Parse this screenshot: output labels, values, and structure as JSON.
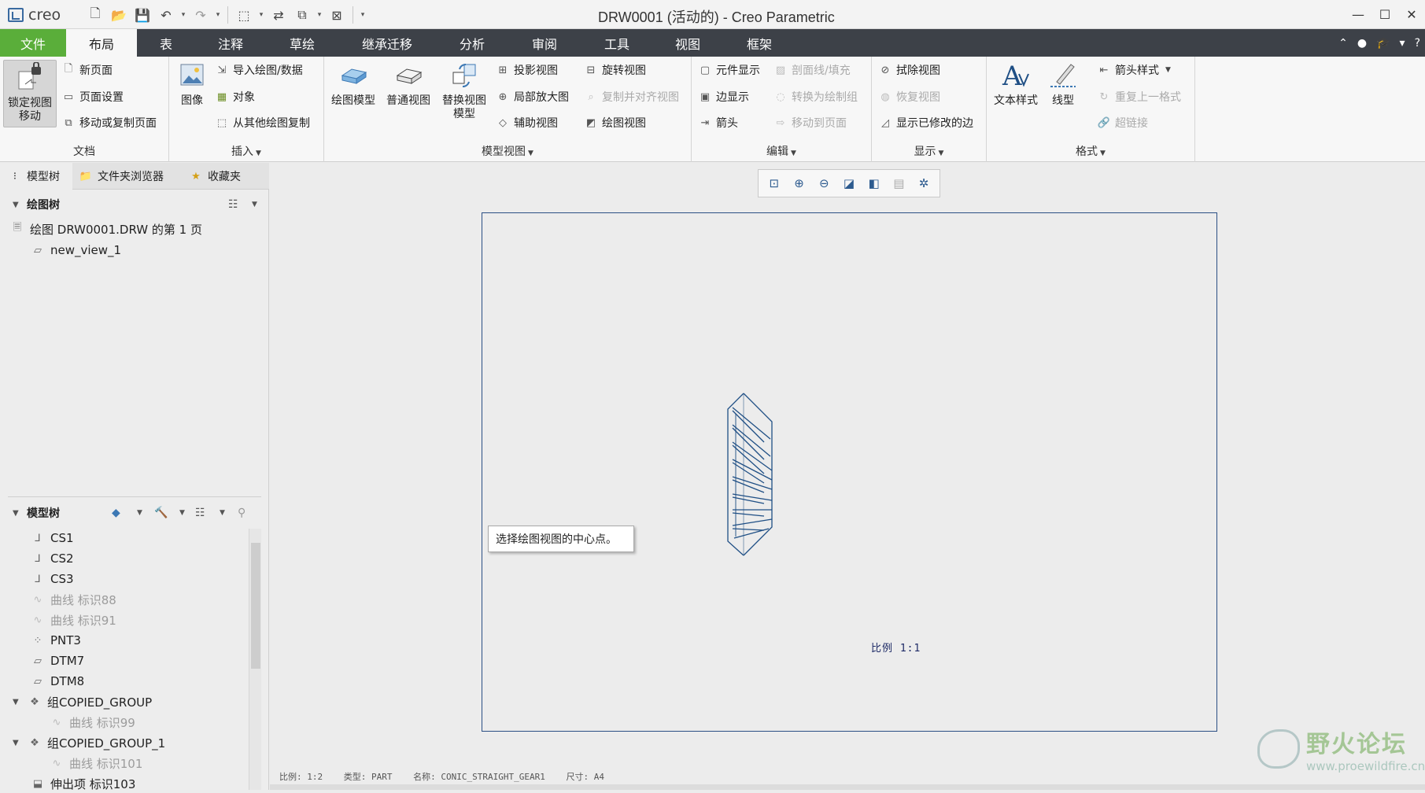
{
  "app": {
    "logo_text": "creo",
    "window_title": "DRW0001 (活动的) - Creo Parametric"
  },
  "menu": {
    "tabs": [
      "文件",
      "布局",
      "表",
      "注释",
      "草绘",
      "继承迁移",
      "分析",
      "审阅",
      "工具",
      "视图",
      "框架"
    ],
    "active_tab": "布局"
  },
  "ribbon": {
    "document": {
      "label": "文档",
      "lock_view": "锁定视图\n移动",
      "new_page": "新页面",
      "page_setup": "页面设置",
      "move_copy_page": "移动或复制页面"
    },
    "insert": {
      "label": "插入",
      "image": "图像",
      "import_data": "导入绘图/数据",
      "object": "对象",
      "copy_from_other": "从其他绘图复制"
    },
    "model_views": {
      "label": "模型视图",
      "drawing_model": "绘图模型",
      "general_view": "普通视图",
      "replace_view_model": "替换视图\n模型",
      "projection_view": "投影视图",
      "detailed_view": "局部放大图",
      "auxiliary_view": "辅助视图",
      "revolved_view": "旋转视图",
      "copy_align_view": "复制并对齐视图",
      "drawing_view": "绘图视图"
    },
    "edit": {
      "label": "编辑",
      "component_display": "元件显示",
      "edge_display": "边显示",
      "arrows": "箭头",
      "hatching": "剖面线/填充",
      "convert_to_draft": "转换为绘制组",
      "move_to_page": "移动到页面"
    },
    "display": {
      "label": "显示",
      "erase_view": "拭除视图",
      "resume_view": "恢复视图",
      "show_modified_edges": "显示已修改的边"
    },
    "format": {
      "label": "格式",
      "text_style": "文本样式",
      "line_style": "线型",
      "arrow_style": "箭头样式",
      "repeat_last_format": "重复上一格式",
      "hyperlink": "超链接"
    }
  },
  "left_panel": {
    "tabs": [
      "模型树",
      "文件夹浏览器",
      "收藏夹"
    ],
    "drawing_tree": {
      "header": "绘图树",
      "items": [
        "绘图 DRW0001.DRW 的第 1 页",
        "new_view_1"
      ]
    },
    "model_tree": {
      "header": "模型树",
      "items": [
        {
          "label": "CS1",
          "icon": "csys-icon",
          "dim": false,
          "expand": false,
          "indent": 0
        },
        {
          "label": "CS2",
          "icon": "csys-icon",
          "dim": false,
          "expand": false,
          "indent": 0
        },
        {
          "label": "CS3",
          "icon": "csys-icon",
          "dim": false,
          "expand": false,
          "indent": 0
        },
        {
          "label": "曲线 标识88",
          "icon": "curve-icon",
          "dim": true,
          "expand": false,
          "indent": 0
        },
        {
          "label": "曲线 标识91",
          "icon": "curve-icon",
          "dim": true,
          "expand": false,
          "indent": 0
        },
        {
          "label": "PNT3",
          "icon": "point-icon",
          "dim": false,
          "expand": false,
          "indent": 0
        },
        {
          "label": "DTM7",
          "icon": "datum-plane-icon",
          "dim": false,
          "expand": false,
          "indent": 0
        },
        {
          "label": "DTM8",
          "icon": "datum-plane-icon",
          "dim": false,
          "expand": false,
          "indent": 0
        },
        {
          "label": "组COPIED_GROUP",
          "icon": "group-icon",
          "dim": false,
          "expand": true,
          "indent": 0
        },
        {
          "label": "曲线 标识99",
          "icon": "curve-icon",
          "dim": true,
          "expand": false,
          "indent": 1
        },
        {
          "label": "组COPIED_GROUP_1",
          "icon": "group-icon",
          "dim": false,
          "expand": true,
          "indent": 0
        },
        {
          "label": "曲线 标识101",
          "icon": "curve-icon",
          "dim": true,
          "expand": false,
          "indent": 1
        },
        {
          "label": "伸出项 标识103",
          "icon": "extrude-icon",
          "dim": false,
          "expand": false,
          "indent": 0
        }
      ]
    }
  },
  "canvas": {
    "prompt_tooltip": "选择绘图视图的中心点。",
    "scale_note": "比例 1:1",
    "status": {
      "scale": "比例: 1:2",
      "type": "类型: PART",
      "name": "名称: CONIC_STRAIGHT_GEAR1",
      "size": "尺寸: A4"
    },
    "watermark_title": "野火论坛",
    "watermark_url": "www.proewildfire.cn"
  },
  "colors": {
    "file_tab": "#5aae3a",
    "menubar": "#3d4148",
    "sheet_border": "#2b4f84",
    "gear_stroke": "#1f4f85"
  }
}
